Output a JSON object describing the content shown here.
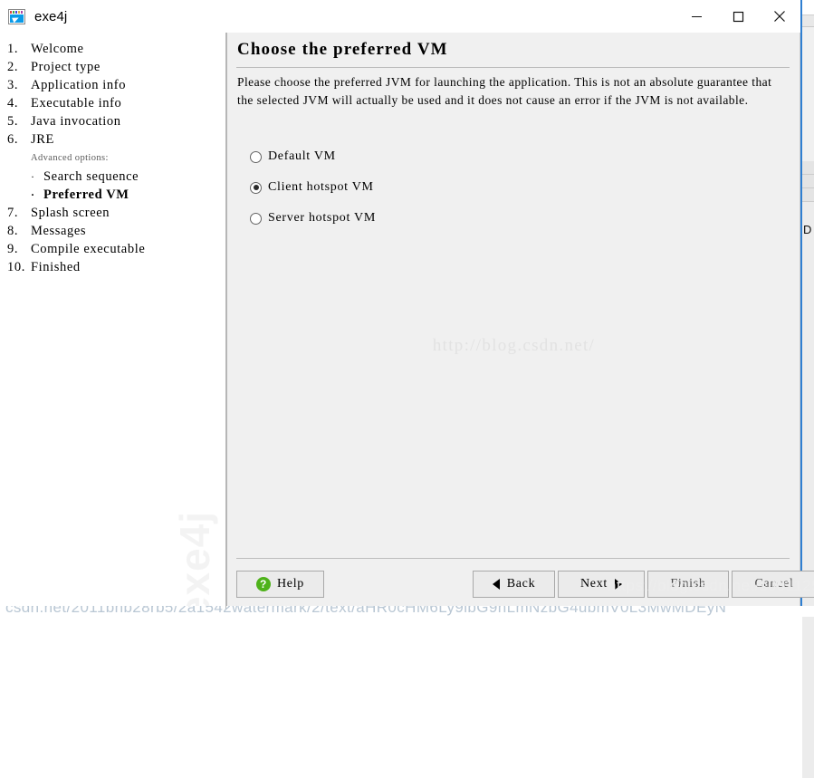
{
  "window": {
    "title": "exe4j",
    "app_icon": "exe4j-app-icon",
    "controls": {
      "minimize": "minimize-icon",
      "maximize": "maximize-icon",
      "close": "close-icon"
    }
  },
  "sidebar": {
    "steps": [
      {
        "num": "1.",
        "label": "Welcome"
      },
      {
        "num": "2.",
        "label": "Project type"
      },
      {
        "num": "3.",
        "label": "Application info"
      },
      {
        "num": "4.",
        "label": "Executable info"
      },
      {
        "num": "5.",
        "label": "Java invocation"
      },
      {
        "num": "6.",
        "label": "JRE"
      }
    ],
    "advanced_heading": "Advanced options:",
    "advanced_items": [
      {
        "bullet": "·",
        "label": "Search sequence",
        "active": false
      },
      {
        "bullet": "·",
        "label": "Preferred VM",
        "active": true
      }
    ],
    "steps_after": [
      {
        "num": "7.",
        "label": "Splash screen"
      },
      {
        "num": "8.",
        "label": "Messages"
      },
      {
        "num": "9.",
        "label": "Compile executable"
      },
      {
        "num": "10.",
        "label": "Finished"
      }
    ],
    "watermark": "exe4j"
  },
  "main": {
    "title": "Choose the preferred VM",
    "description": "Please choose the preferred JVM for launching the application. This is not an absolute guarantee that the selected JVM will actually be used and it does not cause an error if the JVM is not available.",
    "options": [
      {
        "label": "Default VM",
        "selected": false
      },
      {
        "label": "Client hotspot VM",
        "selected": true
      },
      {
        "label": "Server hotspot VM",
        "selected": false
      }
    ],
    "watermark": "http://blog.csdn.net/"
  },
  "buttons": {
    "help": "Help",
    "help_icon": "question-mark-icon",
    "back": "Back",
    "back_icon": "triangle-left-icon",
    "next": "Next",
    "next_icon": "triangle-right-icon",
    "finish": "Finish",
    "cancel": "Cancel"
  },
  "overlays": {
    "button_bar_watermark": "https://blog.csdn.net/s001125",
    "bottom_strip": "csdn.net/2011bhb28rb5/2a1542watermark/2/text/aHR0cHM6Ly9ibG9nLmNzbG4ubmV0L3MwMDEyN"
  },
  "colors": {
    "accent_blue": "#2f7fd1",
    "help_green": "#4eb21a",
    "pane_bg": "#f0f0f0",
    "watermark_gray": "#e2e2e2"
  }
}
